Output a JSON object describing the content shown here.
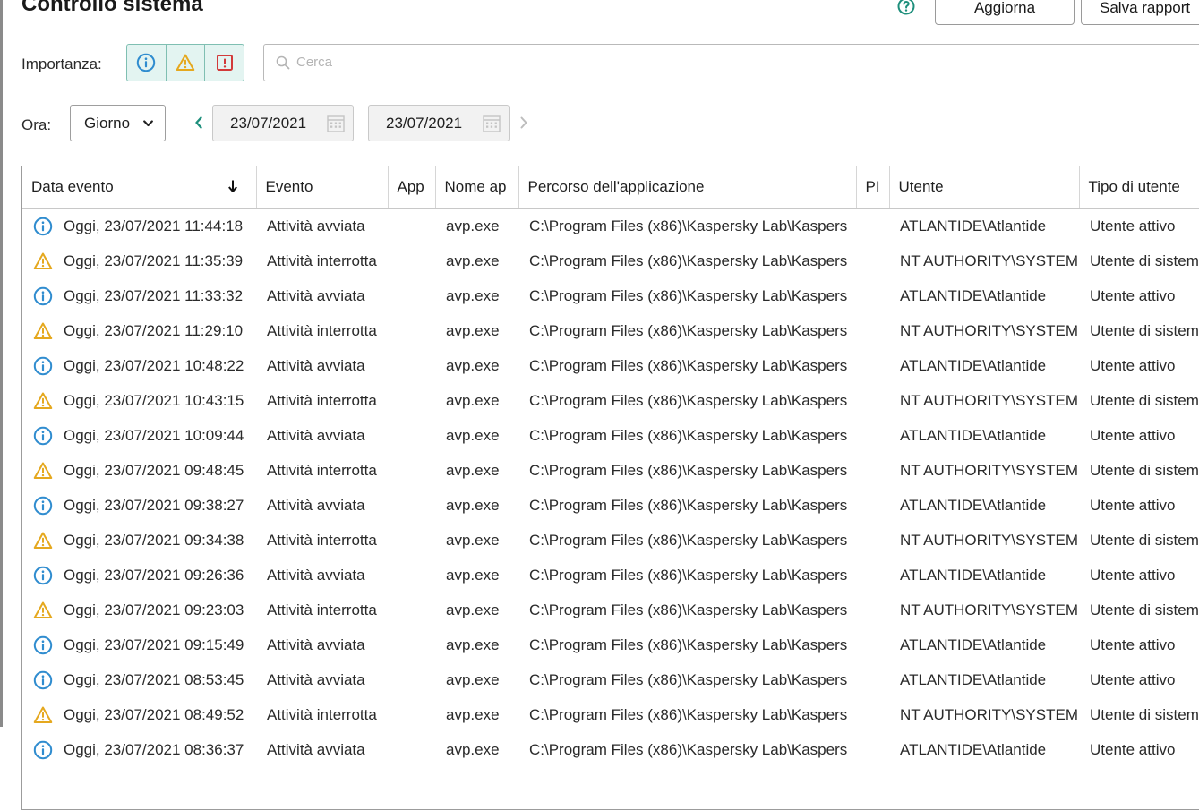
{
  "header": {
    "title": "Controllo sistema",
    "help_icon": "question-circle-icon",
    "refresh_label": "Aggiorna",
    "save_report_label": "Salva rapport"
  },
  "filters": {
    "importance_label": "Importanza:",
    "importance_buttons": [
      {
        "icon": "info-icon",
        "color": "#2f8ccf"
      },
      {
        "icon": "warning-icon",
        "color": "#e5a81e"
      },
      {
        "icon": "critical-icon",
        "color": "#d23a3a"
      }
    ],
    "search_placeholder": "Cerca",
    "time_label": "Ora:",
    "time_period": "Giorno",
    "date_from": "23/07/2021",
    "date_to": "23/07/2021"
  },
  "table": {
    "columns": [
      "Data evento",
      "Evento",
      "App",
      "Nome ap",
      "Percorso dell'applicazione",
      "PI",
      "Utente",
      "Tipo di utente"
    ],
    "sorted_column": "Data evento",
    "sort_direction": "descending",
    "rows": [
      {
        "level": "info",
        "date": "Oggi, 23/07/2021 11:44:18",
        "event": "Attività avviata",
        "app": "",
        "name": "avp.exe",
        "path": "C:\\Program Files (x86)\\Kaspersky Lab\\Kaspers",
        "pid": "",
        "user": "ATLANTIDE\\Atlantide",
        "user_type": "Utente attivo"
      },
      {
        "level": "warning",
        "date": "Oggi, 23/07/2021 11:35:39",
        "event": "Attività interrotta",
        "app": "",
        "name": "avp.exe",
        "path": "C:\\Program Files (x86)\\Kaspersky Lab\\Kaspers",
        "pid": "",
        "user": "NT AUTHORITY\\SYSTEM",
        "user_type": "Utente di sistema"
      },
      {
        "level": "info",
        "date": "Oggi, 23/07/2021 11:33:32",
        "event": "Attività avviata",
        "app": "",
        "name": "avp.exe",
        "path": "C:\\Program Files (x86)\\Kaspersky Lab\\Kaspers",
        "pid": "",
        "user": "ATLANTIDE\\Atlantide",
        "user_type": "Utente attivo"
      },
      {
        "level": "warning",
        "date": "Oggi, 23/07/2021 11:29:10",
        "event": "Attività interrotta",
        "app": "",
        "name": "avp.exe",
        "path": "C:\\Program Files (x86)\\Kaspersky Lab\\Kaspers",
        "pid": "",
        "user": "NT AUTHORITY\\SYSTEM",
        "user_type": "Utente di sistema"
      },
      {
        "level": "info",
        "date": "Oggi, 23/07/2021 10:48:22",
        "event": "Attività avviata",
        "app": "",
        "name": "avp.exe",
        "path": "C:\\Program Files (x86)\\Kaspersky Lab\\Kaspers",
        "pid": "",
        "user": "ATLANTIDE\\Atlantide",
        "user_type": "Utente attivo"
      },
      {
        "level": "warning",
        "date": "Oggi, 23/07/2021 10:43:15",
        "event": "Attività interrotta",
        "app": "",
        "name": "avp.exe",
        "path": "C:\\Program Files (x86)\\Kaspersky Lab\\Kaspers",
        "pid": "",
        "user": "NT AUTHORITY\\SYSTEM",
        "user_type": "Utente di sistema"
      },
      {
        "level": "info",
        "date": "Oggi, 23/07/2021 10:09:44",
        "event": "Attività avviata",
        "app": "",
        "name": "avp.exe",
        "path": "C:\\Program Files (x86)\\Kaspersky Lab\\Kaspers",
        "pid": "",
        "user": "ATLANTIDE\\Atlantide",
        "user_type": "Utente attivo"
      },
      {
        "level": "warning",
        "date": "Oggi, 23/07/2021 09:48:45",
        "event": "Attività interrotta",
        "app": "",
        "name": "avp.exe",
        "path": "C:\\Program Files (x86)\\Kaspersky Lab\\Kaspers",
        "pid": "",
        "user": "NT AUTHORITY\\SYSTEM",
        "user_type": "Utente di sistema"
      },
      {
        "level": "info",
        "date": "Oggi, 23/07/2021 09:38:27",
        "event": "Attività avviata",
        "app": "",
        "name": "avp.exe",
        "path": "C:\\Program Files (x86)\\Kaspersky Lab\\Kaspers",
        "pid": "",
        "user": "ATLANTIDE\\Atlantide",
        "user_type": "Utente attivo"
      },
      {
        "level": "warning",
        "date": "Oggi, 23/07/2021 09:34:38",
        "event": "Attività interrotta",
        "app": "",
        "name": "avp.exe",
        "path": "C:\\Program Files (x86)\\Kaspersky Lab\\Kaspers",
        "pid": "",
        "user": "NT AUTHORITY\\SYSTEM",
        "user_type": "Utente di sistema"
      },
      {
        "level": "info",
        "date": "Oggi, 23/07/2021 09:26:36",
        "event": "Attività avviata",
        "app": "",
        "name": "avp.exe",
        "path": "C:\\Program Files (x86)\\Kaspersky Lab\\Kaspers",
        "pid": "",
        "user": "ATLANTIDE\\Atlantide",
        "user_type": "Utente attivo"
      },
      {
        "level": "warning",
        "date": "Oggi, 23/07/2021 09:23:03",
        "event": "Attività interrotta",
        "app": "",
        "name": "avp.exe",
        "path": "C:\\Program Files (x86)\\Kaspersky Lab\\Kaspers",
        "pid": "",
        "user": "NT AUTHORITY\\SYSTEM",
        "user_type": "Utente di sistema"
      },
      {
        "level": "info",
        "date": "Oggi, 23/07/2021 09:15:49",
        "event": "Attività avviata",
        "app": "",
        "name": "avp.exe",
        "path": "C:\\Program Files (x86)\\Kaspersky Lab\\Kaspers",
        "pid": "",
        "user": "ATLANTIDE\\Atlantide",
        "user_type": "Utente attivo"
      },
      {
        "level": "info",
        "date": "Oggi, 23/07/2021 08:53:45",
        "event": "Attività avviata",
        "app": "",
        "name": "avp.exe",
        "path": "C:\\Program Files (x86)\\Kaspersky Lab\\Kaspers",
        "pid": "",
        "user": "ATLANTIDE\\Atlantide",
        "user_type": "Utente attivo"
      },
      {
        "level": "warning",
        "date": "Oggi, 23/07/2021 08:49:52",
        "event": "Attività interrotta",
        "app": "",
        "name": "avp.exe",
        "path": "C:\\Program Files (x86)\\Kaspersky Lab\\Kaspers",
        "pid": "",
        "user": "NT AUTHORITY\\SYSTEM",
        "user_type": "Utente di sistema"
      },
      {
        "level": "info",
        "date": "Oggi, 23/07/2021 08:36:37",
        "event": "Attività avviata",
        "app": "",
        "name": "avp.exe",
        "path": "C:\\Program Files (x86)\\Kaspersky Lab\\Kaspers",
        "pid": "",
        "user": "ATLANTIDE\\Atlantide",
        "user_type": "Utente attivo"
      }
    ]
  },
  "colors": {
    "info": "#2f8ccf",
    "warning": "#e5a81e",
    "critical": "#d23a3a",
    "accent_teal": "#1e8f7c"
  }
}
